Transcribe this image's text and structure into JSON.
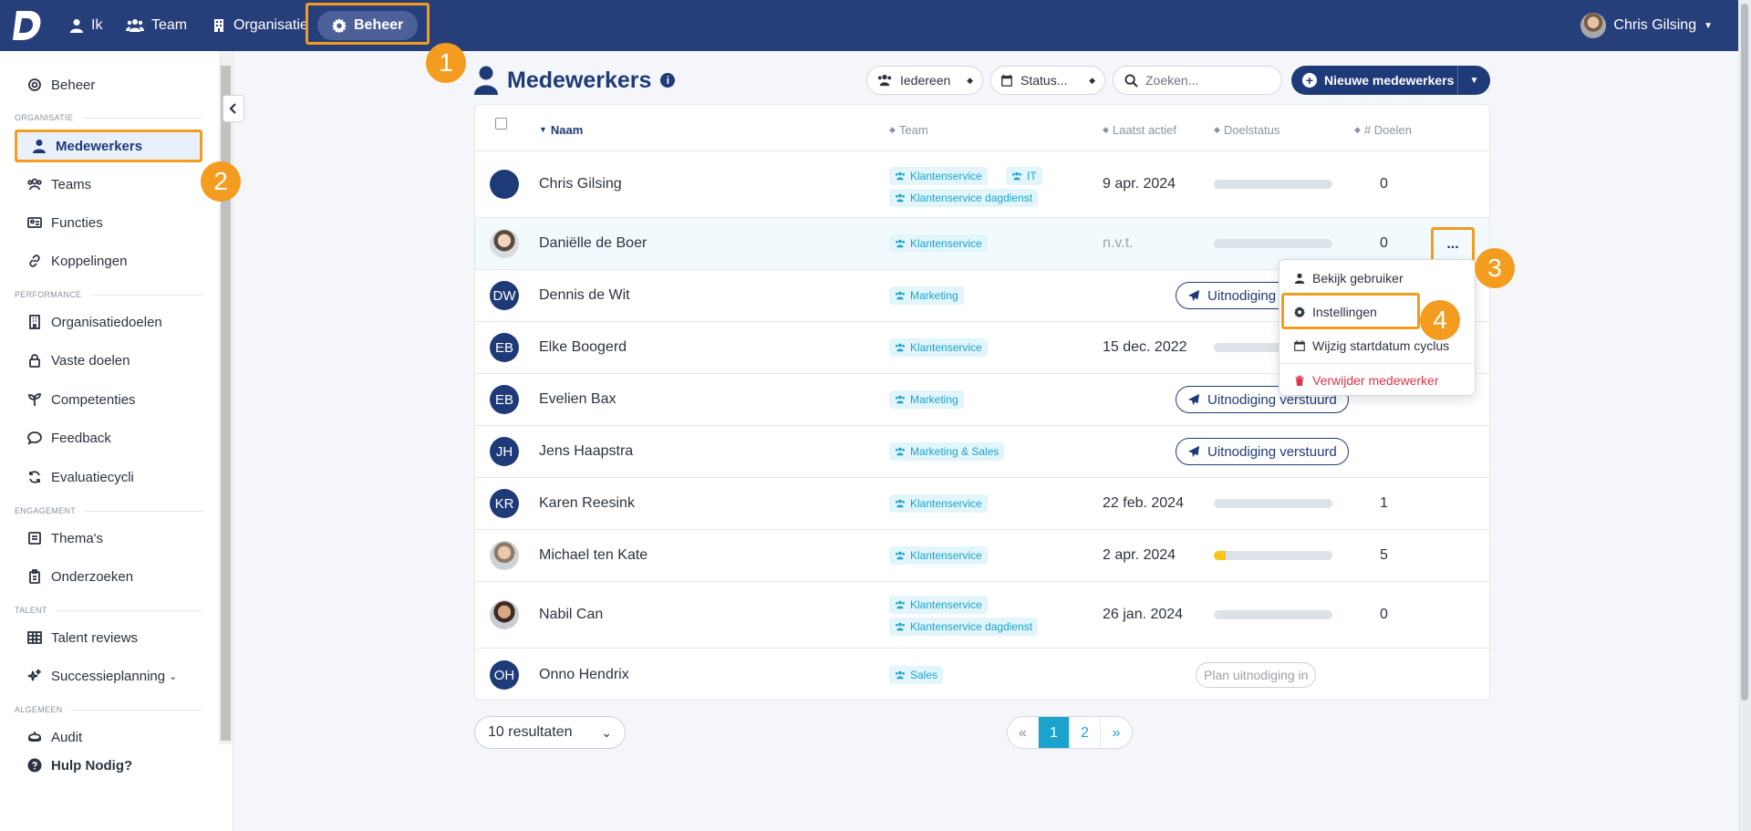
{
  "topnav": {
    "items": [
      {
        "label": "Ik",
        "icon": "user-icon"
      },
      {
        "label": "Team",
        "icon": "users-icon"
      },
      {
        "label": "Organisatie",
        "icon": "building-icon"
      },
      {
        "label": "Beheer",
        "icon": "gear-icon"
      }
    ],
    "user_name": "Chris Gilsing"
  },
  "sidebar": {
    "beheer": "Beheer",
    "sections": {
      "organisatie": "ORGANISATIE",
      "performance": "PERFORMANCE",
      "engagement": "ENGAGEMENT",
      "talent": "TALENT",
      "algemeen": "ALGEMEEN"
    },
    "items": {
      "medewerkers": "Medewerkers",
      "teams": "Teams",
      "functies": "Functies",
      "koppelingen": "Koppelingen",
      "organisatiedoelen": "Organisatiedoelen",
      "vaste_doelen": "Vaste doelen",
      "competenties": "Competenties",
      "feedback": "Feedback",
      "evaluatiecycli": "Evaluatiecycli",
      "themas": "Thema's",
      "onderzoeken": "Onderzoeken",
      "talent_reviews": "Talent reviews",
      "successieplanning": "Successieplanning",
      "audit": "Audit",
      "hulp": "Hulp Nodig?"
    }
  },
  "callouts": [
    "1",
    "2",
    "3",
    "4"
  ],
  "header": {
    "title": "Medewerkers",
    "filter_everyone": "Iedereen",
    "filter_status": "Status...",
    "search_placeholder": "Zoeken...",
    "new_button": "Nieuwe medewerkers"
  },
  "table": {
    "columns": {
      "naam": "Naam",
      "team": "Team",
      "laatst_actief": "Laatst actief",
      "doelstatus": "Doelstatus",
      "doelen": "# Doelen"
    },
    "rows": [
      {
        "initials": "",
        "name": "Chris Gilsing",
        "tags": [
          "Klantenservice",
          "IT",
          "Klantenservice dagdienst"
        ],
        "last_active": "9 apr. 2024",
        "progress": 0,
        "goals": "0"
      },
      {
        "initials": "",
        "name": "Daniëlle de Boer",
        "tags": [
          "Klantenservice"
        ],
        "last_active": "n.v.t.",
        "progress": 0,
        "goals": "0"
      },
      {
        "initials": "DW",
        "name": "Dennis de Wit",
        "tags": [
          "Marketing"
        ],
        "invite": "Uitnodiging v"
      },
      {
        "initials": "EB",
        "name": "Elke Boogerd",
        "tags": [
          "Klantenservice"
        ],
        "last_active": "15 dec. 2022"
      },
      {
        "initials": "EB",
        "name": "Evelien Bax",
        "tags": [
          "Marketing"
        ],
        "invite": "Uitnodiging verstuurd"
      },
      {
        "initials": "JH",
        "name": "Jens Haapstra",
        "tags": [
          "Marketing & Sales"
        ],
        "invite": "Uitnodiging verstuurd"
      },
      {
        "initials": "KR",
        "name": "Karen Reesink",
        "tags": [
          "Klantenservice"
        ],
        "last_active": "22 feb. 2024",
        "progress": 0,
        "goals": "1"
      },
      {
        "initials": "",
        "name": "Michael ten Kate",
        "tags": [
          "Klantenservice"
        ],
        "last_active": "2 apr. 2024",
        "progress": 0.1,
        "goals": "5"
      },
      {
        "initials": "",
        "name": "Nabil Can",
        "tags": [
          "Klantenservice",
          "Klantenservice dagdienst"
        ],
        "last_active": "26 jan. 2024",
        "progress": 0,
        "goals": "0"
      },
      {
        "initials": "OH",
        "name": "Onno Hendrix",
        "tags": [
          "Sales"
        ],
        "plan": "Plan uitnodiging in"
      }
    ],
    "row_menu_icon": "..."
  },
  "row_menu": {
    "items": [
      "Bekijk gebruiker",
      "Instellingen",
      "Wijzig startdatum cyclus",
      "Verwijder medewerker"
    ]
  },
  "pagination": {
    "results": "10 resultaten",
    "prev": "«",
    "pages": [
      "1",
      "2"
    ],
    "next": "»",
    "current": 1
  },
  "colors": {
    "topbar": "#263e7a",
    "accent": "#1aa3cc",
    "highlight": "#f39c1f",
    "danger": "#dc3545"
  }
}
